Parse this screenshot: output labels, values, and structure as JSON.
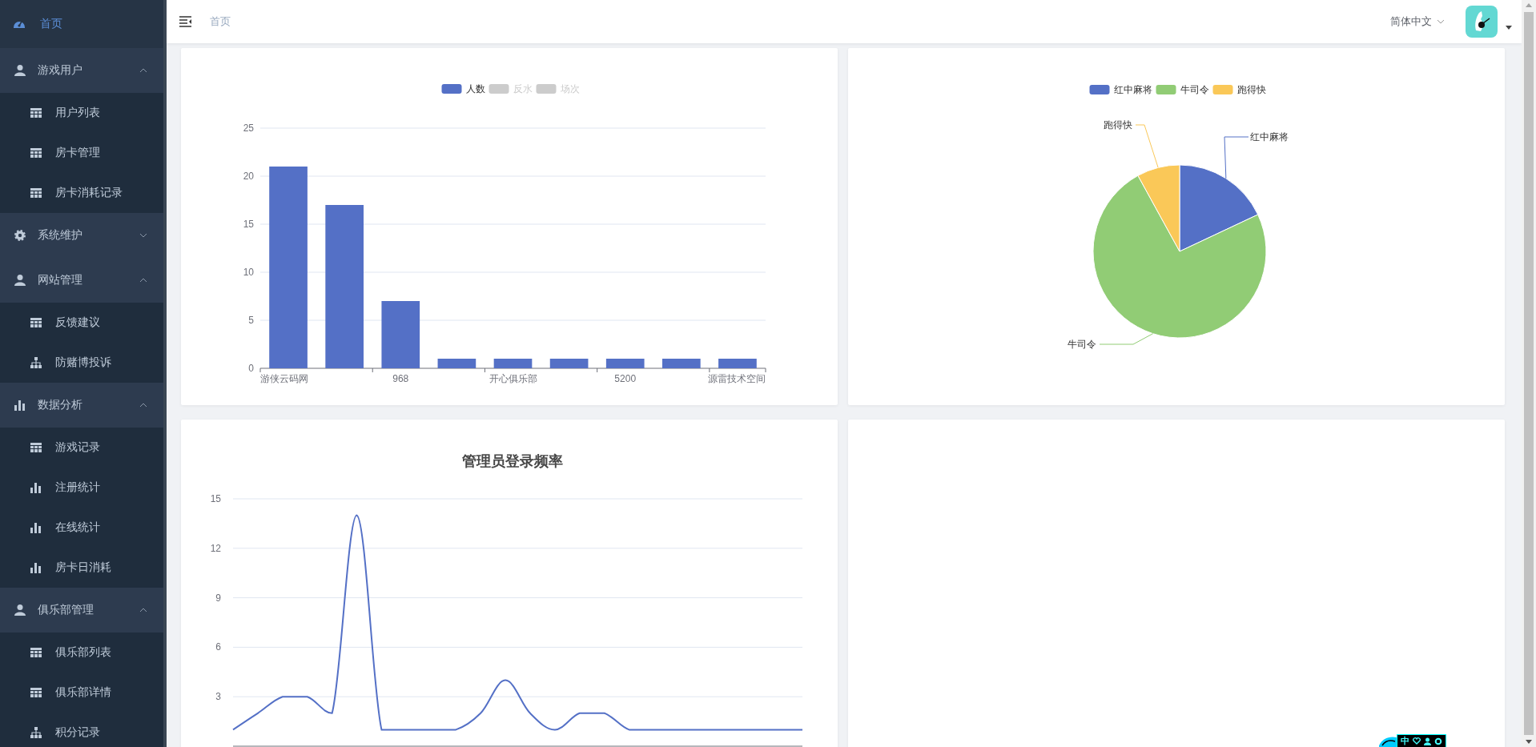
{
  "sidebar": {
    "items": [
      {
        "label": "首页",
        "kind": "dashboard",
        "selected": true
      },
      {
        "label": "游戏用户",
        "kind": "user",
        "selected": false,
        "expanded": true,
        "children": [
          {
            "label": "用户列表",
            "kind": "table",
            "selected": false
          },
          {
            "label": "房卡管理",
            "kind": "table",
            "selected": false
          },
          {
            "label": "房卡消耗记录",
            "kind": "table",
            "selected": false
          }
        ]
      },
      {
        "label": "系统维护",
        "kind": "gear",
        "selected": false,
        "expanded": false
      },
      {
        "label": "网站管理",
        "kind": "user",
        "selected": false,
        "expanded": true,
        "children": [
          {
            "label": "反馈建议",
            "kind": "table",
            "selected": false
          },
          {
            "label": "防赌博投诉",
            "kind": "tree",
            "selected": false
          }
        ]
      },
      {
        "label": "数据分析",
        "kind": "chart",
        "selected": false,
        "expanded": true,
        "children": [
          {
            "label": "游戏记录",
            "kind": "table",
            "selected": false
          },
          {
            "label": "注册统计",
            "kind": "chart",
            "selected": false
          },
          {
            "label": "在线统计",
            "kind": "chart",
            "selected": false
          },
          {
            "label": "房卡日消耗",
            "kind": "chart",
            "selected": false
          }
        ]
      },
      {
        "label": "俱乐部管理",
        "kind": "user",
        "selected": false,
        "expanded": true,
        "children": [
          {
            "label": "俱乐部列表",
            "kind": "table",
            "selected": false
          },
          {
            "label": "俱乐部详情",
            "kind": "table",
            "selected": false
          },
          {
            "label": "积分记录",
            "kind": "tree",
            "selected": false
          }
        ]
      }
    ]
  },
  "header": {
    "breadcrumb": "首页",
    "language": "简体中文"
  },
  "cards": [
    {
      "legend": [
        {
          "name": "人数",
          "color": "#5470c6",
          "on": true
        },
        {
          "name": "反水",
          "on": false
        },
        {
          "name": "场次",
          "on": false
        }
      ],
      "chart_data": {
        "type": "bar",
        "grid": true,
        "categories": [
          "游侠云码网",
          null,
          "968",
          null,
          "开心俱乐部",
          null,
          "5200",
          null,
          "源雷技术空间"
        ],
        "series": [
          {
            "color": "#5470c6",
            "values": [
              21,
              17,
              7,
              1,
              1,
              1,
              1,
              1,
              1
            ]
          }
        ],
        "ylim": [
          0,
          25
        ],
        "yticks": [
          0,
          5,
          10,
          15,
          20,
          25
        ]
      }
    },
    {
      "kind": "pie",
      "legend": [
        {
          "name": "红中麻将",
          "color": "#5470c6"
        },
        {
          "name": "牛司令",
          "color": "#91cc75"
        },
        {
          "name": "跑得快",
          "color": "#fac858"
        }
      ],
      "slices": [
        {
          "label": "红中麻将",
          "color": "#5470c6"
        },
        {
          "label": "牛司令",
          "color": "#91cc75"
        },
        {
          "label": "跑得快",
          "color": "#fac858"
        }
      ]
    },
    {
      "chart_data": {
        "type": "line",
        "title": "管理员登录频率",
        "grid": true,
        "series": [
          {
            "color": "#5470c6",
            "values": [
              1,
              2,
              3,
              3,
              2,
              14,
              1,
              1,
              1,
              1,
              2,
              4,
              2,
              1,
              2,
              2,
              1,
              1,
              1,
              1,
              1,
              1,
              1,
              1
            ]
          }
        ],
        "ylim": [
          0,
          15
        ],
        "yticks": [
          3,
          6,
          9,
          12,
          15
        ]
      }
    },
    {
      "kind": "empty"
    }
  ],
  "input_toolbar": {
    "mode": "中"
  }
}
